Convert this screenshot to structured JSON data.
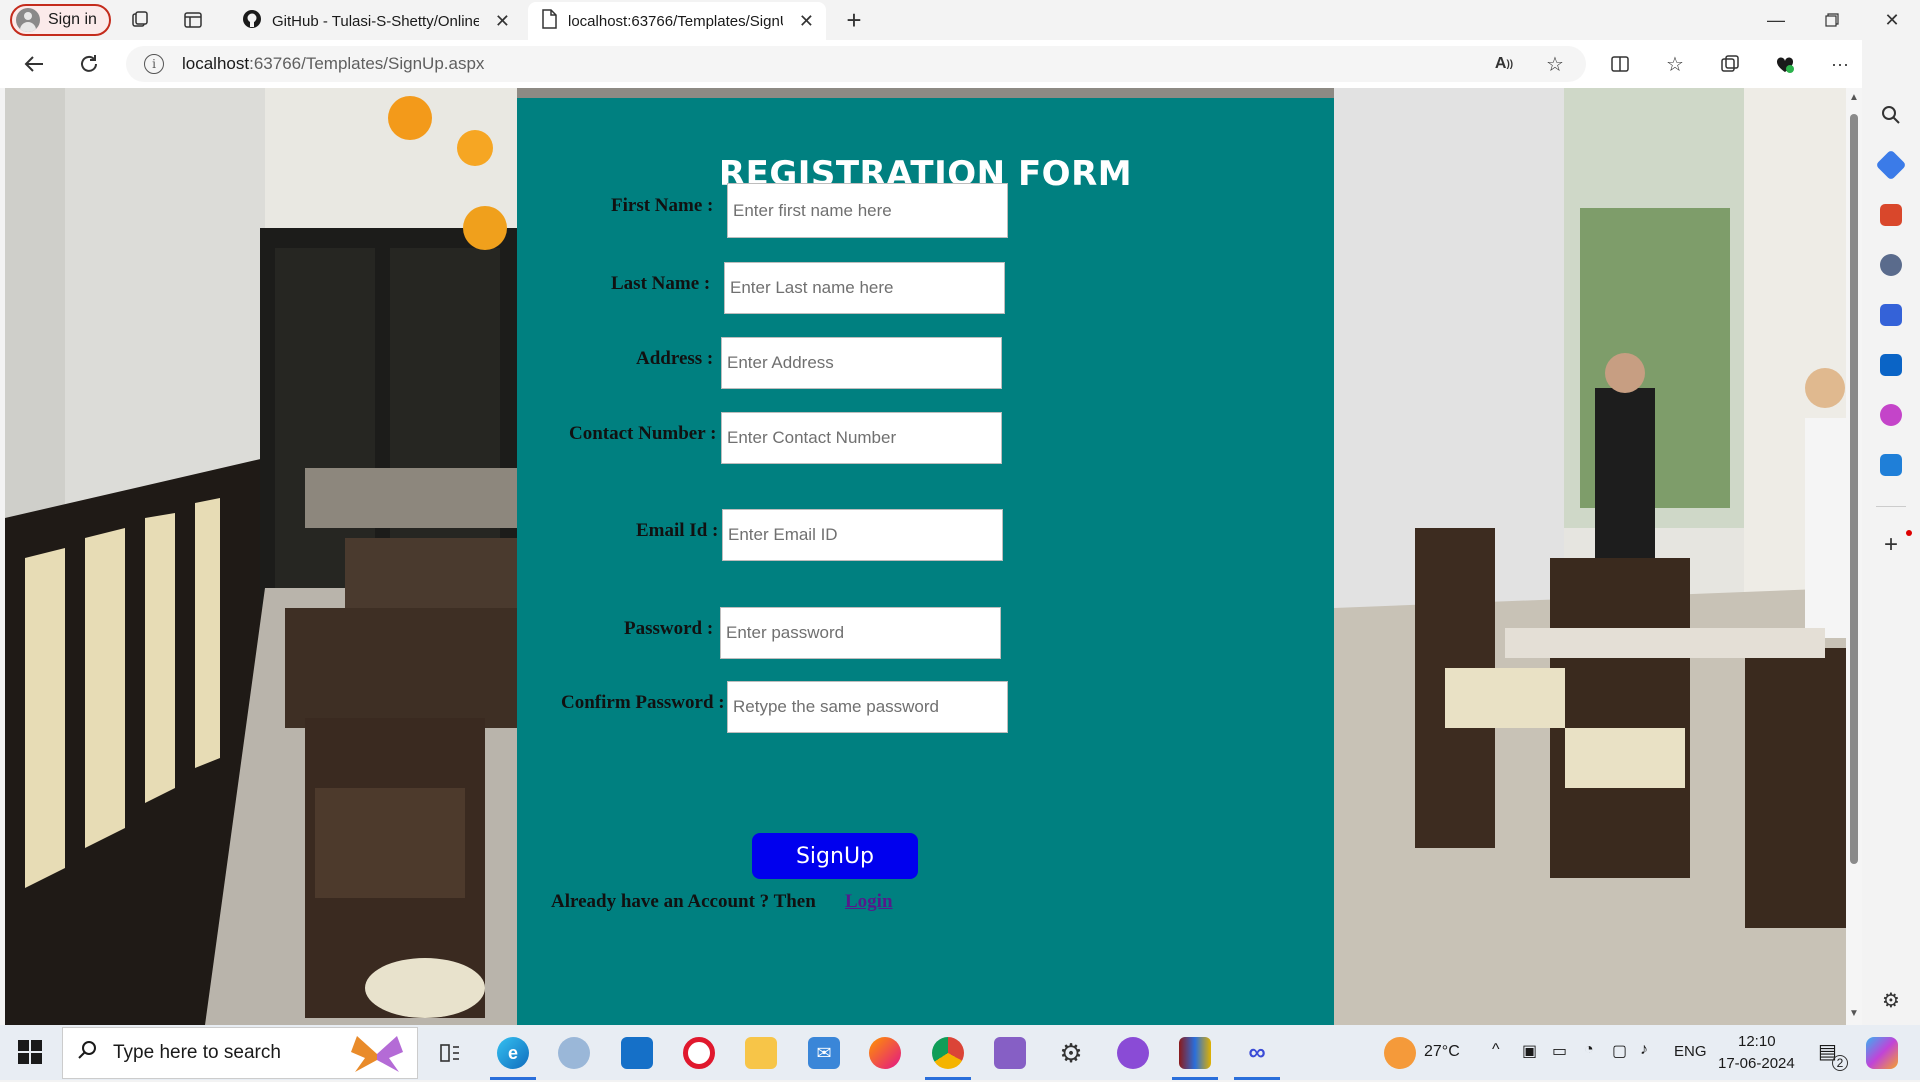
{
  "browser": {
    "signin_label": "Sign in",
    "tabs": [
      {
        "title": "GitHub - Tulasi-S-Shetty/Online-",
        "active": false
      },
      {
        "title": "localhost:63766/Templates/SignU",
        "active": true
      }
    ],
    "address": {
      "host": "localhost",
      "path": ":63766/Templates/SignUp.aspx"
    }
  },
  "form": {
    "title": "REGISTRATION FORM",
    "fields": [
      {
        "label": "First Name :",
        "placeholder": "Enter first name here"
      },
      {
        "label": "Last Name :",
        "placeholder": "Enter Last name here"
      },
      {
        "label": "Address :",
        "placeholder": "Enter Address"
      },
      {
        "label": "Contact Number :",
        "placeholder": "Enter Contact Number"
      },
      {
        "label": "Email Id :",
        "placeholder": "Enter Email ID"
      },
      {
        "label": "Password :",
        "placeholder": "Enter password"
      },
      {
        "label": "Confirm Password :",
        "placeholder": "Retype the same password"
      }
    ],
    "signup_label": "SignUp",
    "already_text": "Already have an Account ? Then",
    "login_label": "Login"
  },
  "taskbar": {
    "search_placeholder": "Type here to search",
    "weather": "27°C",
    "language": "ENG",
    "time": "12:10",
    "date": "17-06-2024",
    "notification_count": "2"
  },
  "colors": {
    "form_bg": "#008080",
    "signup_bg": "#0000ee",
    "link": "#551a8b"
  }
}
